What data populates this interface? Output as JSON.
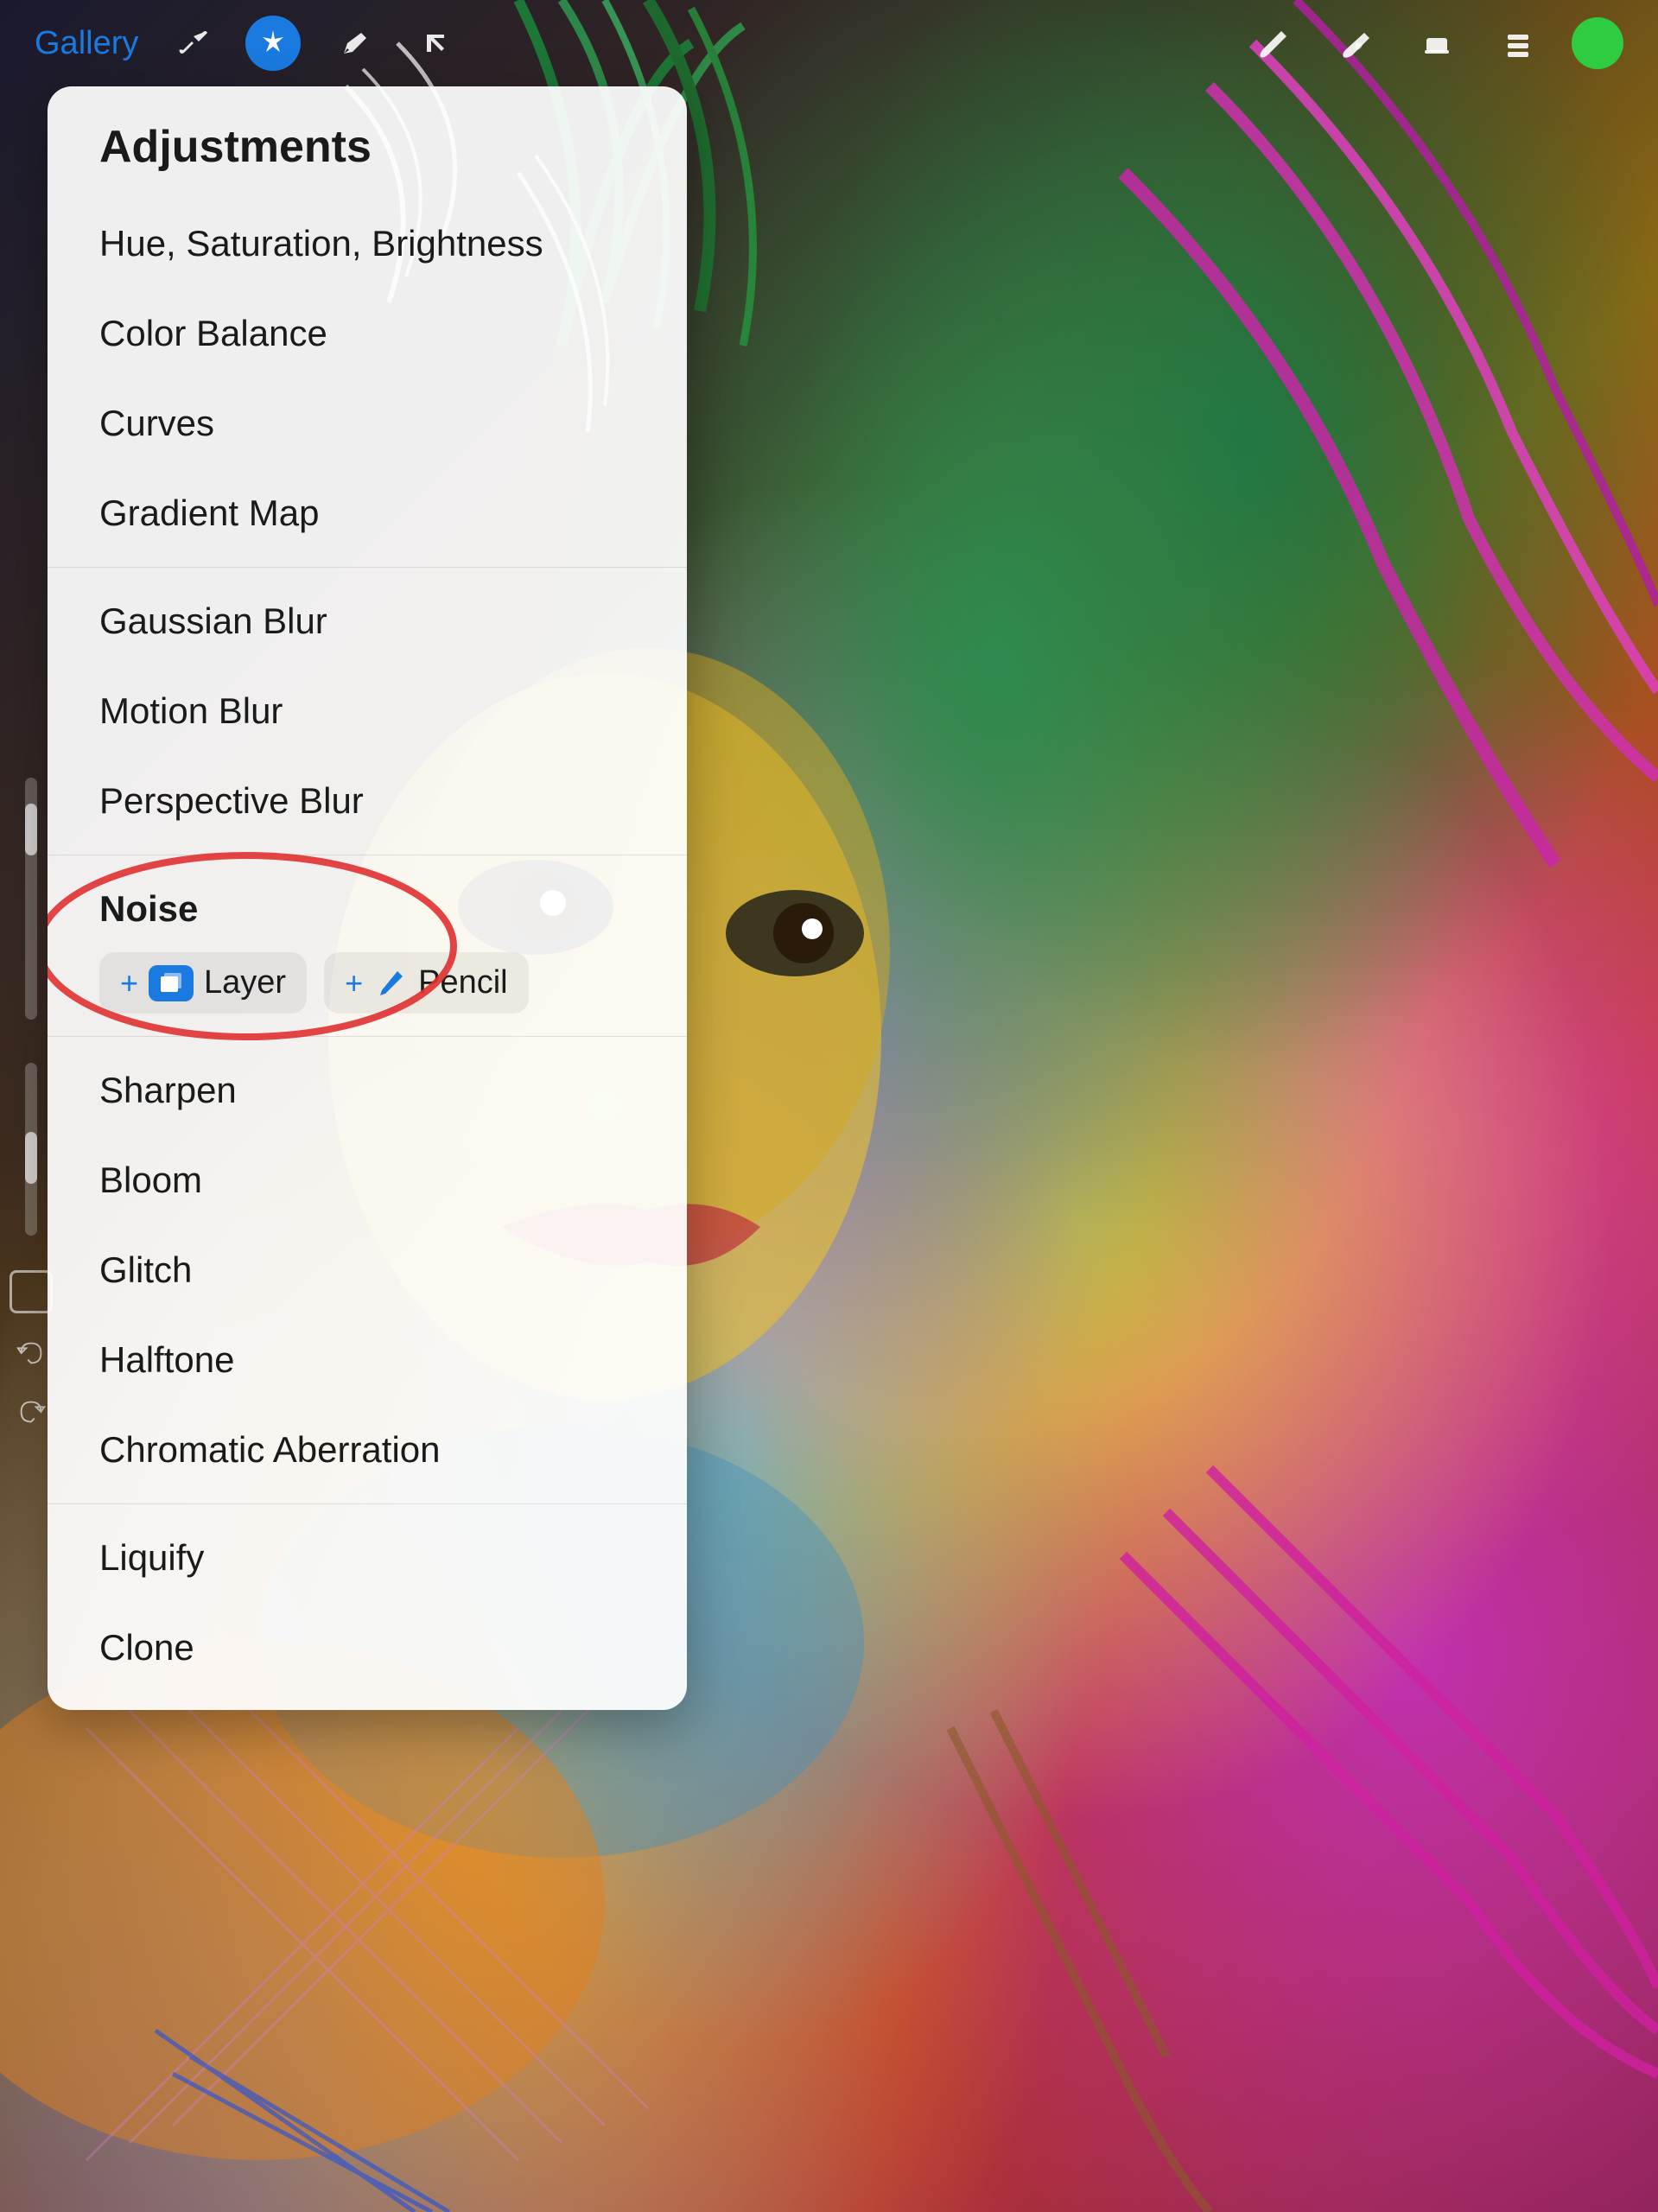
{
  "toolbar": {
    "gallery_label": "Gallery",
    "icons": [
      "wrench-icon",
      "magic-icon",
      "pen-icon",
      "arrow-icon"
    ],
    "right_icons": [
      "brush-icon",
      "smudge-icon",
      "eraser-icon",
      "layers-icon"
    ],
    "color_dot_color": "#2ecc40"
  },
  "panel": {
    "title": "Adjustments",
    "items": [
      {
        "label": "Hue, Saturation, Brightness",
        "section": "color"
      },
      {
        "label": "Color Balance",
        "section": "color"
      },
      {
        "label": "Curves",
        "section": "color"
      },
      {
        "label": "Gradient Map",
        "section": "color"
      },
      {
        "label": "Gaussian Blur",
        "section": "blur"
      },
      {
        "label": "Motion Blur",
        "section": "blur"
      },
      {
        "label": "Perspective Blur",
        "section": "blur"
      }
    ],
    "noise_section": {
      "header": "Noise",
      "layer_label": "Layer",
      "pencil_label": "Pencil"
    },
    "after_noise_items": [
      {
        "label": "Sharpen"
      },
      {
        "label": "Bloom"
      },
      {
        "label": "Glitch"
      },
      {
        "label": "Halftone"
      },
      {
        "label": "Chromatic Aberration"
      }
    ],
    "bottom_items": [
      {
        "label": "Liquify"
      },
      {
        "label": "Clone"
      }
    ]
  }
}
